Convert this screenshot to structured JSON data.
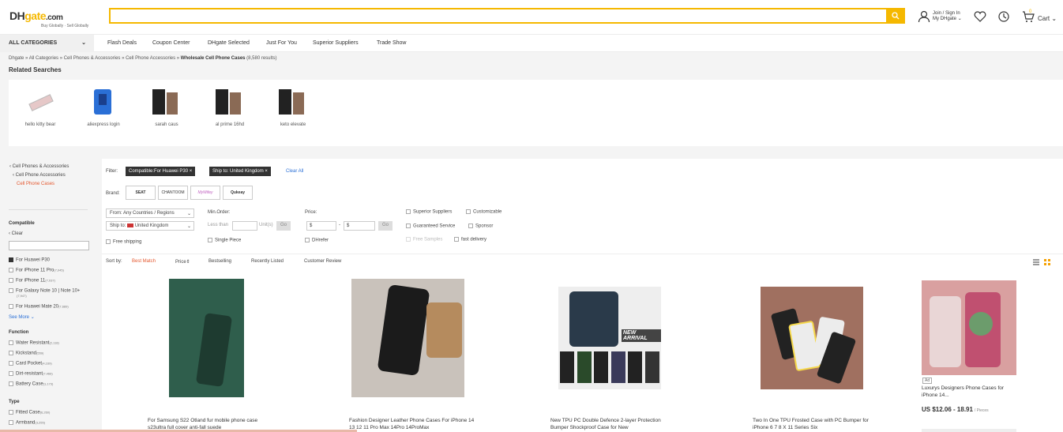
{
  "header": {
    "logo_main": "DH",
    "logo_accent": "gate",
    "logo_suffix": ".com",
    "tagline": "Buy Globally · Sell Globally",
    "search_placeholder": "",
    "account_line1": "Join / Sign In",
    "account_line2": "My DHgate",
    "cart_label": "Cart",
    "cart_count": "0"
  },
  "nav": {
    "all_categories": "ALL CATEGORIES",
    "links": [
      "Flash Deals",
      "Coupon Center",
      "DHgate Selected",
      "Just For You",
      "Superior Suppliers",
      "Trade Show"
    ]
  },
  "breadcrumb": {
    "path": "Dhgate » All Categories » Cell Phones & Accessories » Cell Phone Accessories » ",
    "current": "Wholesale Cell Phone Cases",
    "count": " (8,580 results)"
  },
  "related": {
    "title": "Related Searches",
    "items": [
      "hello kitty bear",
      "aliexpress login",
      "sarah caus",
      "al prime 16hd",
      "keto elevate"
    ]
  },
  "sidebar": {
    "cats": [
      "‹ Cell Phones & Accessories",
      "‹ Cell Phone Accessories",
      "Cell Phone Cases"
    ],
    "compatible_title": "Compatible",
    "clear": "‹ Clear",
    "compatible": [
      {
        "label": "For Huawei P30",
        "count": ""
      },
      {
        "label": "For iPhone 11 Pro",
        "count": "(7,045)"
      },
      {
        "label": "For iPhone 11",
        "count": "(7,037)"
      },
      {
        "label": "For Galaxy Note 10 | Note 10+",
        "count": "(7,947)"
      },
      {
        "label": "For Huawei Mate 20",
        "count": "(7,689)"
      }
    ],
    "see_more": "See More",
    "function_title": "Function",
    "function": [
      {
        "label": "Water Resistant",
        "count": "(2,118)"
      },
      {
        "label": "Kickstand",
        "count": "(559)"
      },
      {
        "label": "Card Pocket",
        "count": "(4,169)"
      },
      {
        "label": "Dirt-resistant",
        "count": "(7,466)"
      },
      {
        "label": "Battery Case",
        "count": "(1,173)"
      }
    ],
    "type_title": "Type",
    "type": [
      {
        "label": "Fitted Case",
        "count": "(6,260)"
      },
      {
        "label": "Armband",
        "count": "(3,255)"
      }
    ]
  },
  "filter": {
    "label": "Filter:",
    "chips": [
      "Compatible:For Huawei P30",
      "Ship to: United Kingdom"
    ],
    "clear_all": "Clear All",
    "brand_label": "Brand:",
    "brands": [
      "SEAT",
      "CHANTOOM",
      "MyWifey",
      "Qukeay"
    ],
    "from": "From: Any Countries / Regions",
    "ship_to": "Ship to:",
    "ship_country": "United Kingdom",
    "free_shipping": "Free shipping",
    "min_order": "Min.Order:",
    "less_than": "Less than",
    "units": "Unit(s)",
    "go": "Go",
    "single_piece": "Single Piece",
    "price": "Price:",
    "price_sym_a": "$",
    "price_sym_b": "$",
    "price_dash": "-",
    "dhrefer": "DHrefer",
    "options": [
      "Superior Suppliers",
      "Customizable",
      "Guaranteed Service",
      "Sponsor",
      "Free Samples",
      "fast delivery"
    ]
  },
  "sort": {
    "label": "Sort by:",
    "items": [
      "Best Match",
      "Price",
      "Bestselling",
      "Recently Listed",
      "Customer Review"
    ]
  },
  "products": [
    {
      "title": "For Samsung S22 Otland fur mobile phone case s23ultra full cover anti-fall suede",
      "price": "",
      "unit": ""
    },
    {
      "title": "Fashion Designer Leather Phone Cases For iPhone 14 13 12 11 Pro Max 14Pro 14ProMax",
      "price": "",
      "unit": ""
    },
    {
      "title": "New TPU PC Double Defence 2-layer Protection Bumper Shockproof Case for New",
      "price": "",
      "unit": ""
    },
    {
      "title": "Two In One TPU Frosted Case with PC Bumper for iPhone 6 7 8 X 11 Series Six",
      "price": "",
      "unit": ""
    },
    {
      "title": "Luxurys Designers Phone Cases for iPhone 14...",
      "price": "US $12.06 - 18.91",
      "unit": "/ Pieces",
      "ad": "Ad"
    }
  ],
  "colors": {
    "accent": "#f5b800",
    "link_red": "#e4572e",
    "chip": "#333333"
  }
}
